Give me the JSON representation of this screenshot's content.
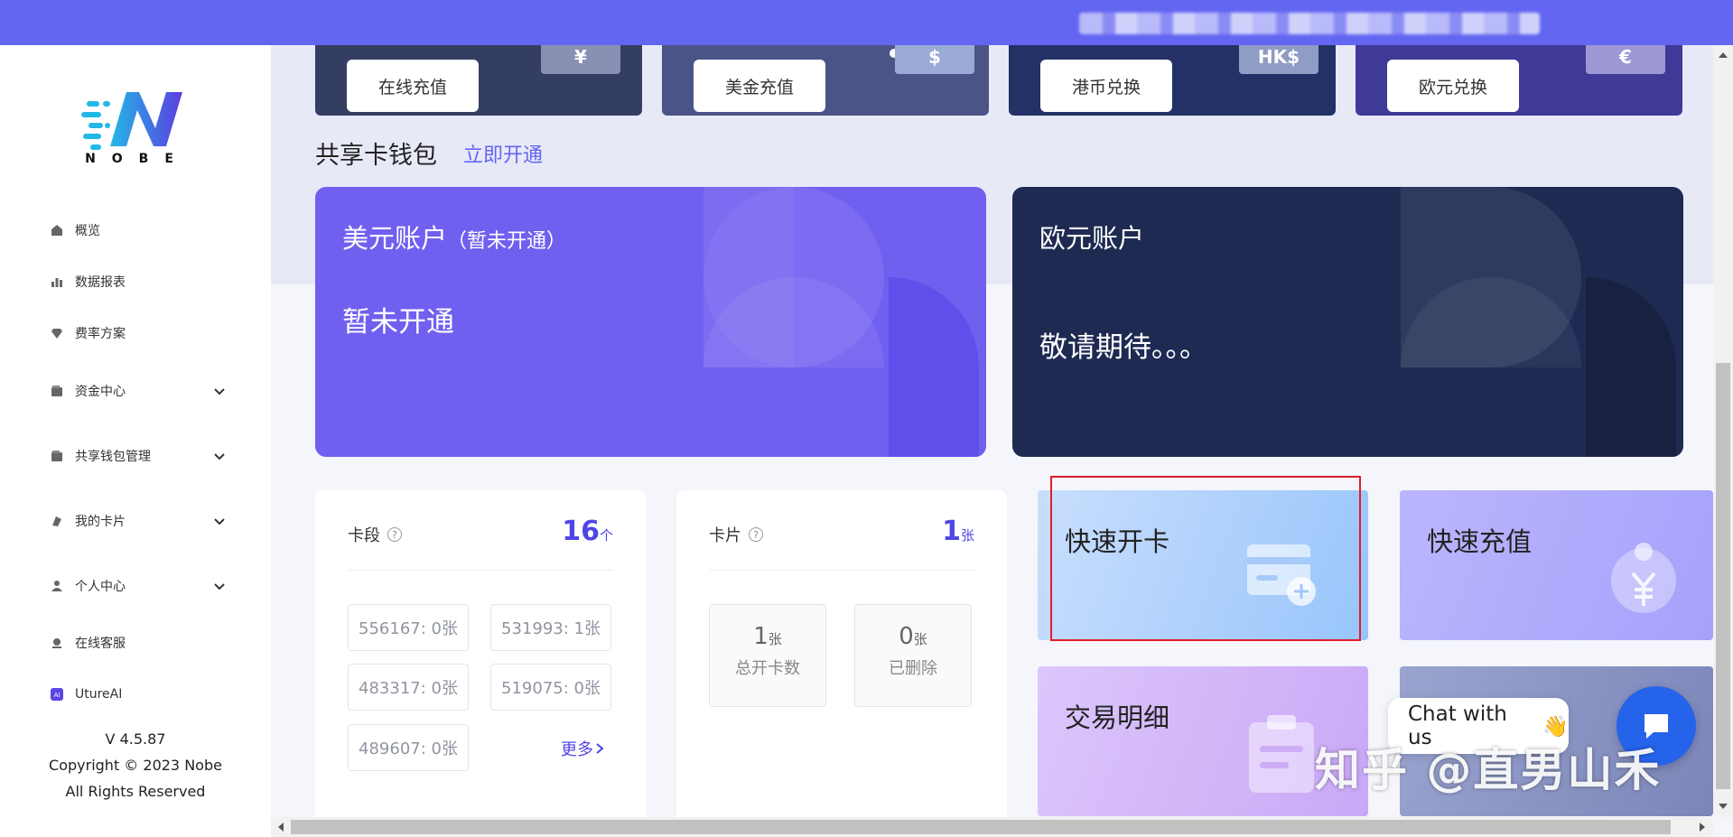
{
  "sidebar": {
    "logo_text": "NOBE",
    "items": [
      {
        "label": "概览",
        "icon": "home-icon",
        "expandable": false
      },
      {
        "label": "数据报表",
        "icon": "bar-chart-icon",
        "expandable": false
      },
      {
        "label": "费率方案",
        "icon": "diamond-icon",
        "expandable": false
      },
      {
        "label": "资金中心",
        "icon": "wallet-icon",
        "expandable": true
      },
      {
        "label": "共享钱包管理",
        "icon": "wallet-icon",
        "expandable": true
      },
      {
        "label": "我的卡片",
        "icon": "card-icon",
        "expandable": true
      },
      {
        "label": "个人中心",
        "icon": "user-icon",
        "expandable": true
      },
      {
        "label": "在线客服",
        "icon": "support-icon",
        "expandable": false
      },
      {
        "label": "UtureAI",
        "icon": "ai-icon",
        "expandable": false
      }
    ],
    "version": "V 4.5.87",
    "copyright": "Copyright © 2023 Nobe",
    "rights": "All Rights Reserved"
  },
  "top_cards": [
    {
      "button": "在线充值",
      "chip": "¥"
    },
    {
      "button": "美金充值",
      "chip": "$"
    },
    {
      "button": "港币兑换",
      "chip": "HK$"
    },
    {
      "button": "欧元兑换",
      "chip": "€"
    }
  ],
  "shared_wallet": {
    "title": "共享卡钱包",
    "link": "立即开通"
  },
  "accounts": [
    {
      "title": "美元账户",
      "suffix": "（暂未开通）",
      "status": "暂未开通"
    },
    {
      "title": "欧元账户",
      "suffix": "",
      "status": "敬请期待。。。"
    }
  ],
  "card_segments": {
    "label": "卡段",
    "count": "16",
    "unit": "个",
    "segments": [
      "556167: 0张",
      "531993: 1张",
      "483317: 0张",
      "519075: 0张",
      "489607: 0张"
    ],
    "more": "更多"
  },
  "cards": {
    "label": "卡片",
    "count": "1",
    "unit": "张",
    "total": {
      "value": "1",
      "unit": "张",
      "label": "总开卡数"
    },
    "deleted": {
      "value": "0",
      "unit": "张",
      "label": "已删除"
    }
  },
  "quick_actions": [
    {
      "title": "快速开卡",
      "icon": "add-card-icon"
    },
    {
      "title": "快速充值",
      "icon": "yuan-add-icon"
    },
    {
      "title": "交易明细",
      "icon": "clipboard-icon"
    },
    {
      "title": "",
      "icon": ""
    }
  ],
  "chat": {
    "text": "Chat with us",
    "emoji": "👋"
  },
  "watermark": "知乎 @直男山禾",
  "colors": {
    "brand": "#6366f1",
    "navy": "#1e2a52",
    "highlight": "#e11d2a"
  }
}
